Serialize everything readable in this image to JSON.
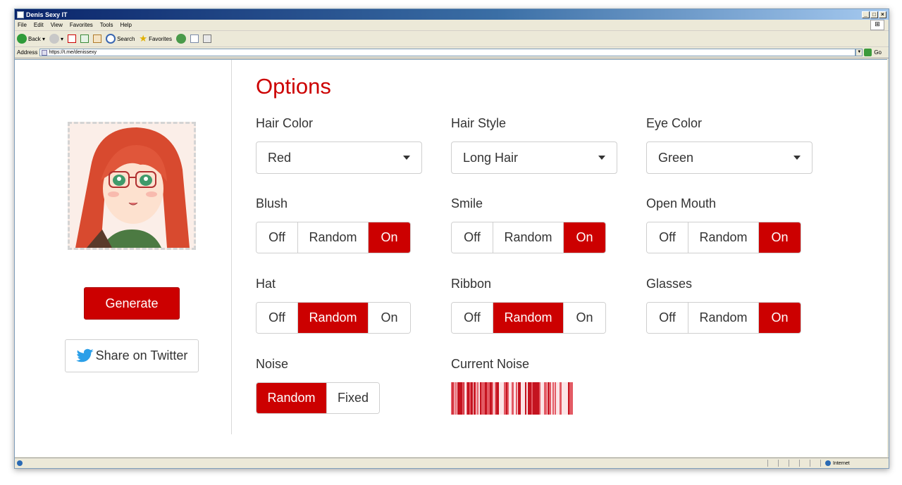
{
  "window": {
    "title": "Denis Sexy IT",
    "controls": [
      "_",
      "□",
      "×"
    ]
  },
  "menu": [
    "File",
    "Edit",
    "View",
    "Favorites",
    "Tools",
    "Help"
  ],
  "toolbar": {
    "back": "Back",
    "search": "Search",
    "favorites": "Favorites"
  },
  "address": {
    "label": "Address",
    "url": "https://t.me/denissexy",
    "go": "Go"
  },
  "status": {
    "zone": "Internet"
  },
  "sidebar": {
    "generate_label": "Generate",
    "share_label": "Share on Twitter"
  },
  "options": {
    "title": "Options",
    "hair_color": {
      "label": "Hair Color",
      "value": "Red"
    },
    "hair_style": {
      "label": "Hair Style",
      "value": "Long Hair"
    },
    "eye_color": {
      "label": "Eye Color",
      "value": "Green"
    },
    "toggle_labels": {
      "off": "Off",
      "random": "Random",
      "on": "On"
    },
    "blush": {
      "label": "Blush",
      "selected": "On"
    },
    "smile": {
      "label": "Smile",
      "selected": "On"
    },
    "open_mouth": {
      "label": "Open Mouth",
      "selected": "On"
    },
    "hat": {
      "label": "Hat",
      "selected": "Random"
    },
    "ribbon": {
      "label": "Ribbon",
      "selected": "Random"
    },
    "glasses": {
      "label": "Glasses",
      "selected": "On"
    },
    "noise": {
      "label": "Noise",
      "random": "Random",
      "fixed": "Fixed",
      "selected": "Random"
    },
    "current_noise": {
      "label": "Current Noise"
    }
  },
  "colors": {
    "accent": "#cc0000",
    "border": "#cfcfcf",
    "text": "#333333"
  }
}
